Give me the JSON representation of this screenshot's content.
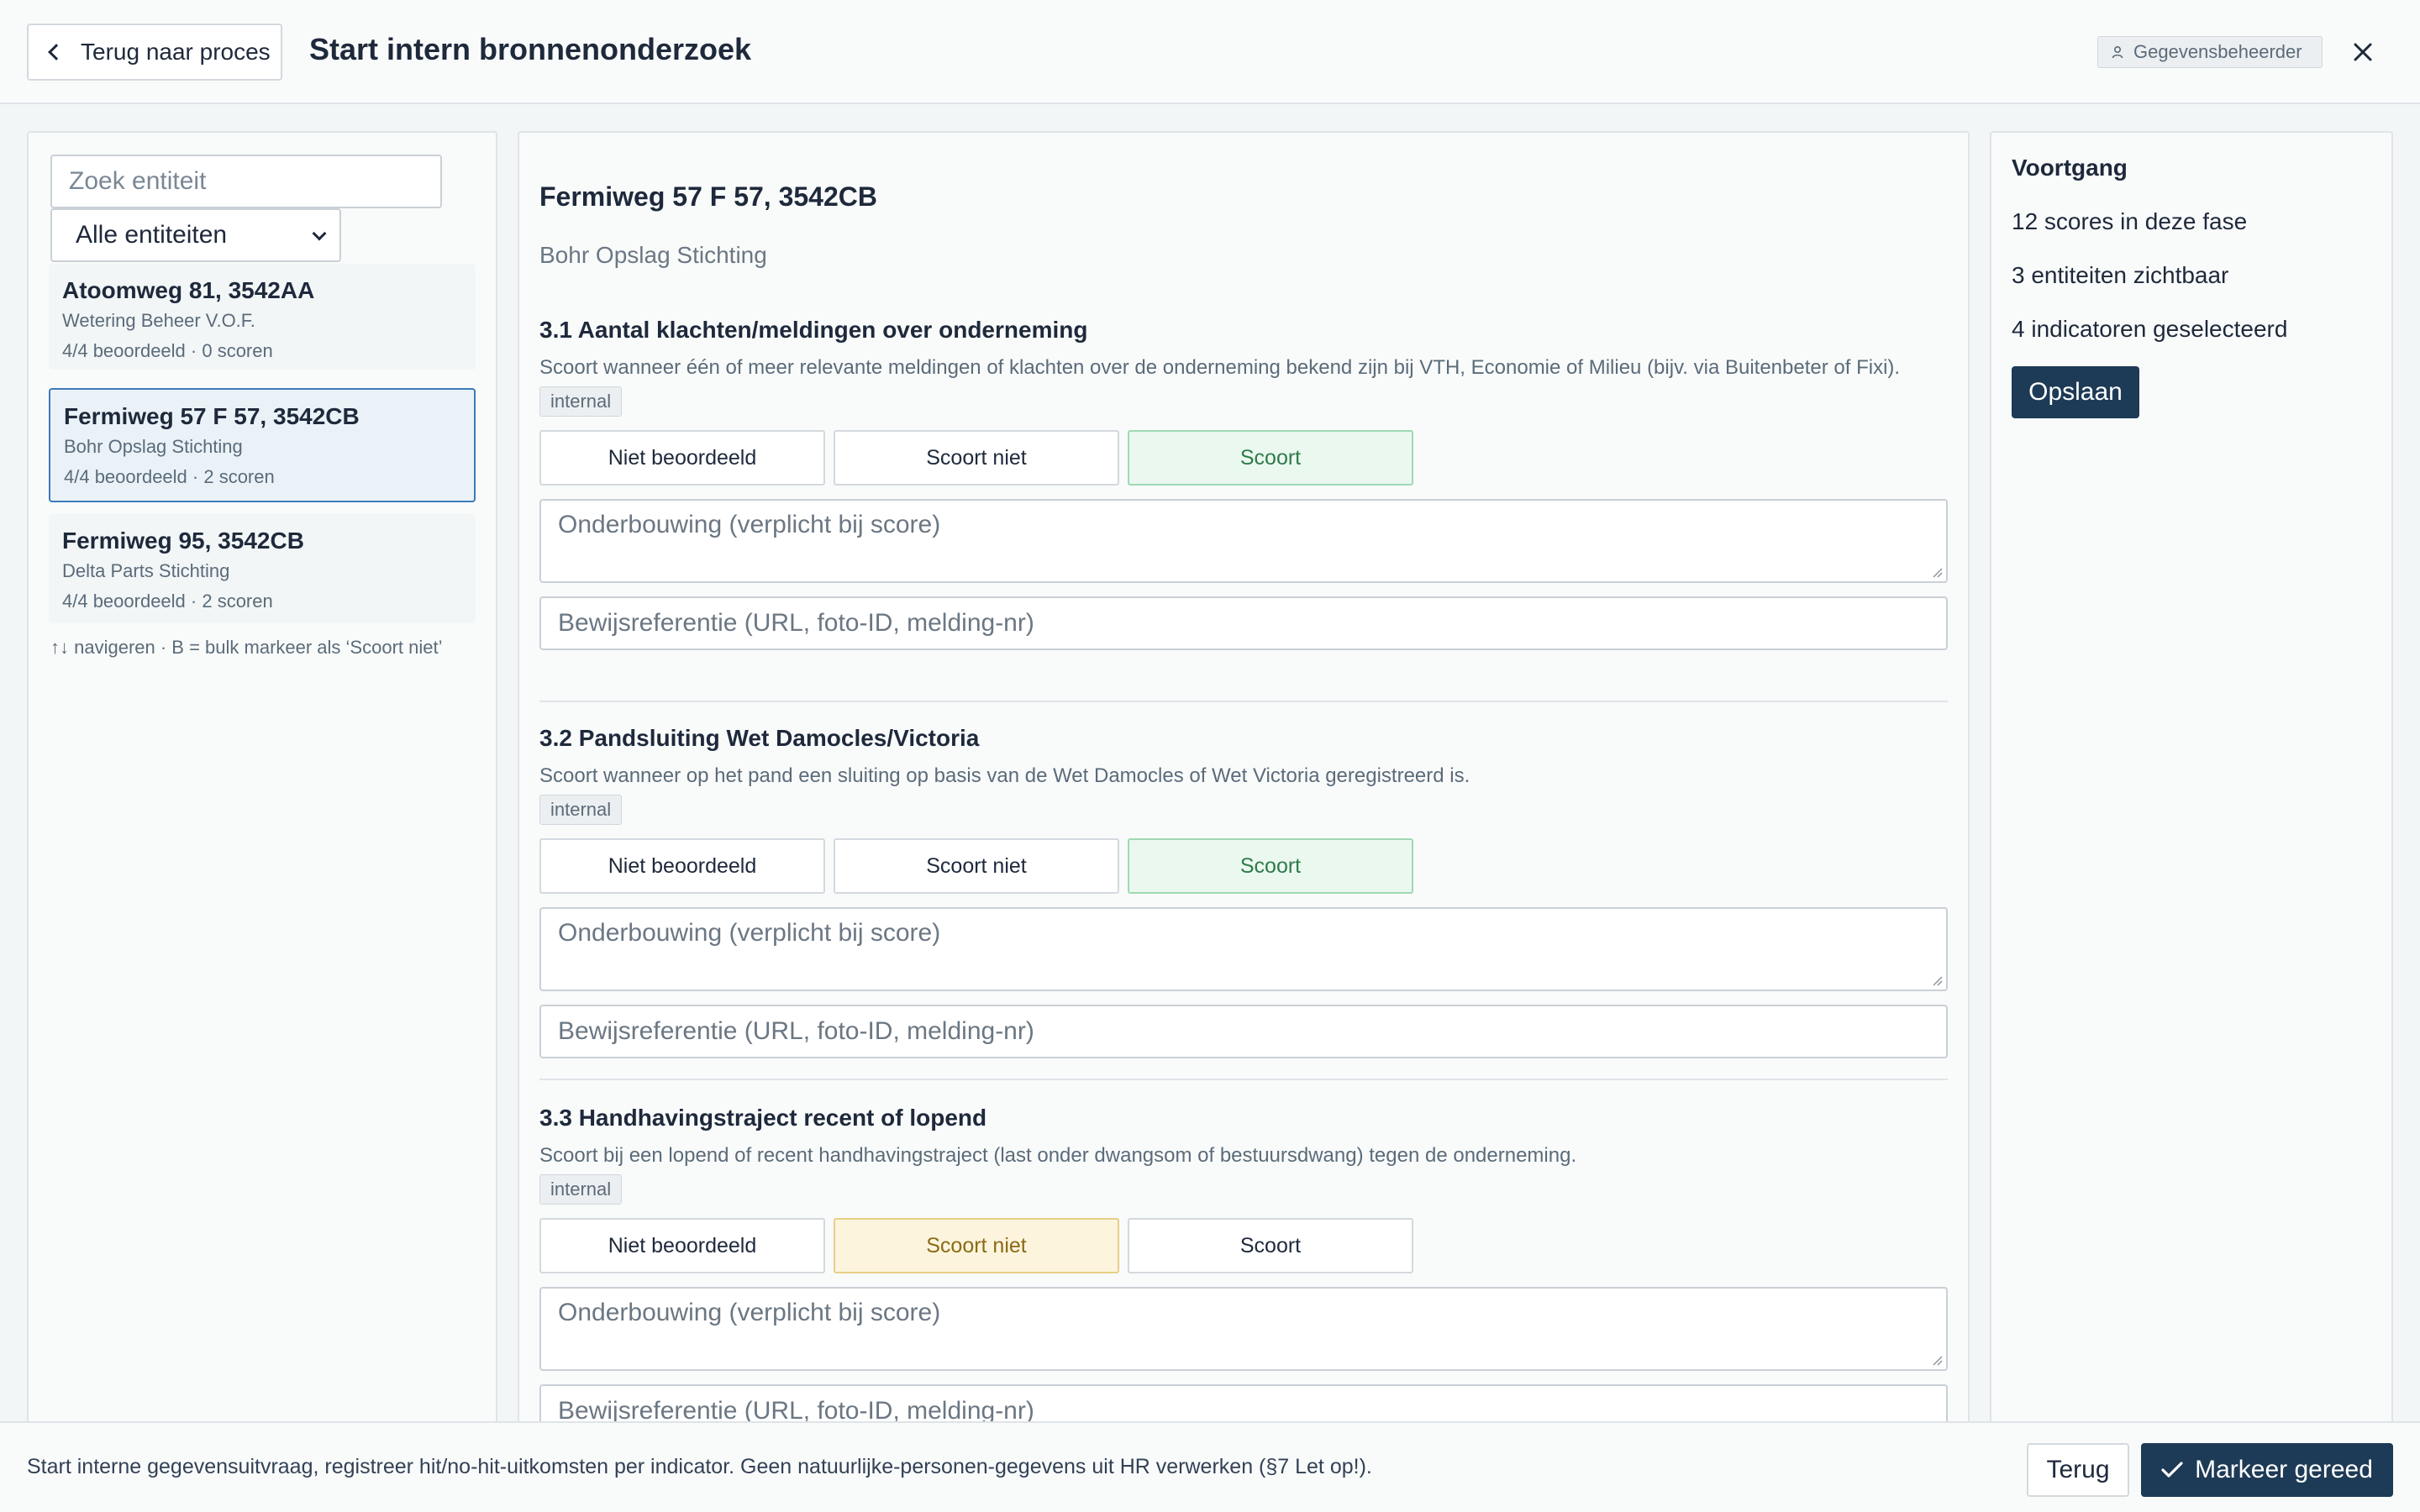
{
  "header": {
    "back_label": "Terug naar proces",
    "title": "Start intern bronnenonderzoek",
    "role_badge": "Gegevensbeheerder",
    "icons": {
      "back": "chevron-left-icon",
      "role": "user-icon",
      "close": "close-icon"
    }
  },
  "sidebar": {
    "search_placeholder": "Zoek entiteit",
    "filter_value": "Alle entiteiten",
    "entities": [
      {
        "address": "Atoomweg 81, 3542AA",
        "org": "Wetering Beheer V.O.F.",
        "stats": "4/4 beoordeeld · 0 scoren",
        "selected": false
      },
      {
        "address": "Fermiweg 57 F 57, 3542CB",
        "org": "Bohr Opslag Stichting",
        "stats": "4/4 beoordeeld · 2 scoren",
        "selected": true
      },
      {
        "address": "Fermiweg 95, 3542CB",
        "org": "Delta Parts Stichting",
        "stats": "4/4 beoordeeld · 2 scoren",
        "selected": false
      }
    ],
    "hint": "↑↓ navigeren · B = bulk markeer als ‘Scoort niet’"
  },
  "main": {
    "title": "Fermiweg 57 F 57, 3542CB",
    "subtitle": "Bohr Opslag Stichting",
    "button_labels": {
      "not_assessed": "Niet beoordeeld",
      "not_scoring": "Scoort niet",
      "scoring": "Scoort"
    },
    "justification_placeholder": "Onderbouwing (verplicht bij score)",
    "evidence_placeholder": "Bewijsreferentie (URL, foto-ID, melding-nr)",
    "indicators": [
      {
        "title": "3.1 Aantal klachten/meldingen over onderneming",
        "description": "Scoort wanneer één of meer relevante meldingen of klachten over de onderneming bekend zijn bij VTH, Economie of Milieu (bijv. via Buitenbeter of Fixi).",
        "tag": "internal",
        "selected": "scoring"
      },
      {
        "title": "3.2 Pandsluiting Wet Damocles/Victoria",
        "description": "Scoort wanneer op het pand een sluiting op basis van de Wet Damocles of Wet Victoria geregistreerd is.",
        "tag": "internal",
        "selected": "scoring"
      },
      {
        "title": "3.3 Handhavingstraject recent of lopend",
        "description": "Scoort bij een lopend of recent handhavingstraject (last onder dwangsom of bestuursdwang) tegen de onderneming.",
        "tag": "internal",
        "selected": "not_scoring"
      }
    ]
  },
  "progress": {
    "title": "Voortgang",
    "lines": [
      "12 scores in deze fase",
      "3 entiteiten zichtbaar",
      "4 indicatoren geselecteerd"
    ],
    "save_label": "Opslaan"
  },
  "footer": {
    "text": "Start interne gegevensuitvraag, registreer hit/no-hit-uitkomsten per indicator. Geen natuurlijke-personen-gegevens uit HR verwerken (§7 Let op!).",
    "back_label": "Terug",
    "done_label": "Markeer gereed",
    "done_icon": "check-icon"
  },
  "colors": {
    "primary": "#1d3a56",
    "selected_score_bg": "#eaf8ef",
    "selected_score_text": "#2f7a4c",
    "selected_not_bg": "#fdf4dd",
    "selected_not_text": "#8a6a14",
    "active_entity_border": "#3d7ab8"
  }
}
